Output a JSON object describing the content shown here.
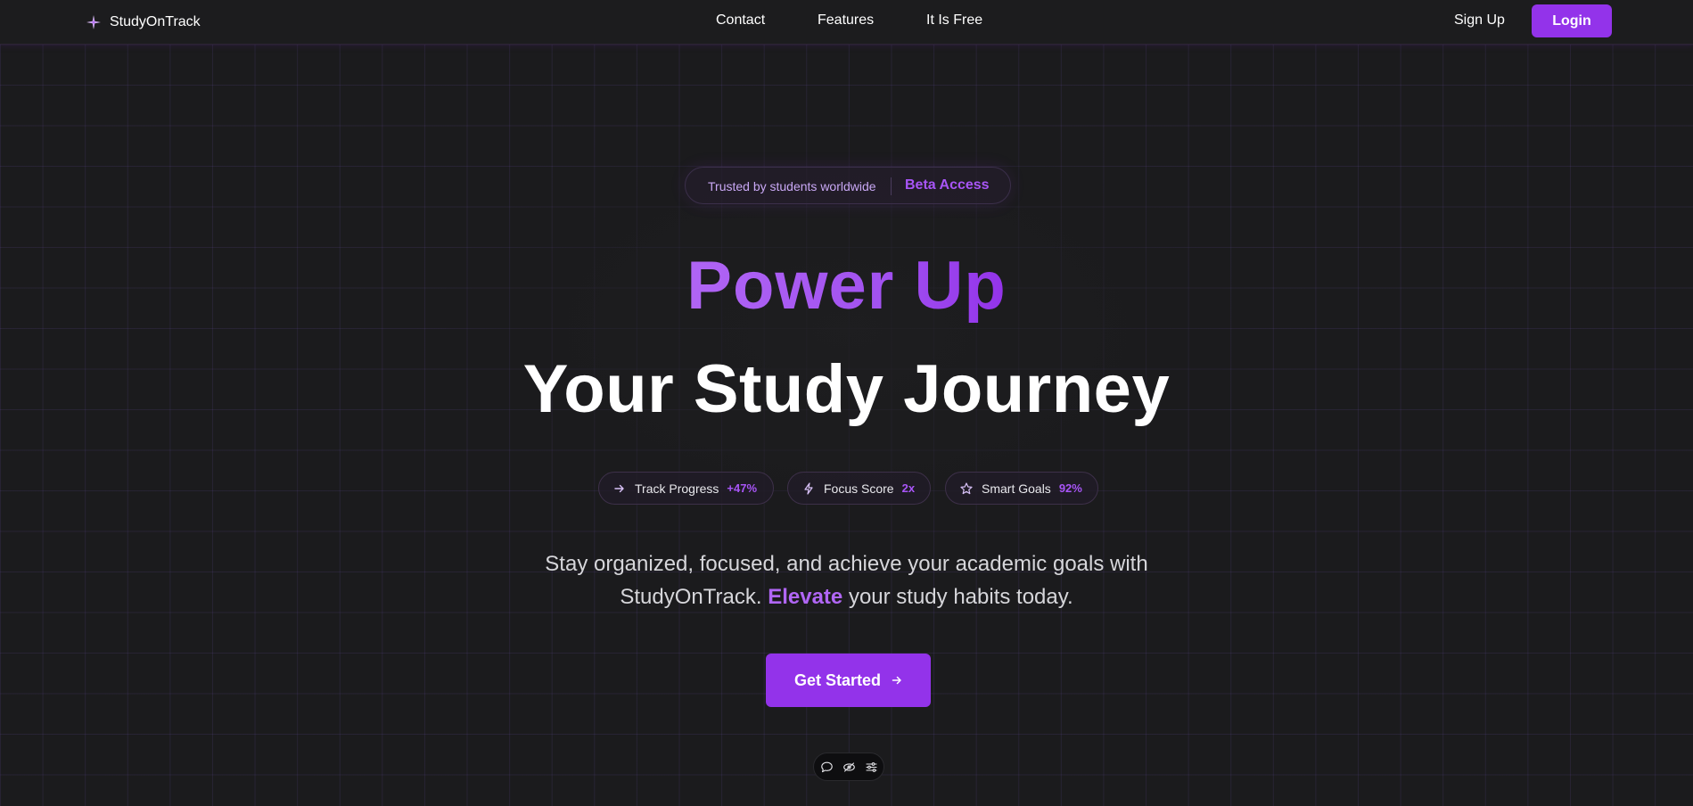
{
  "brand": {
    "name": "StudyOnTrack",
    "icon": "sparkle-icon"
  },
  "nav": {
    "links": [
      "Contact",
      "Features",
      "It Is Free"
    ],
    "signup_label": "Sign Up",
    "login_label": "Login"
  },
  "hero": {
    "badge": {
      "text": "Trusted by students worldwide",
      "highlight": "Beta Access"
    },
    "title_line1": "Power Up",
    "title_line2": "Your Study Journey",
    "stats": [
      {
        "icon": "arrow-right-icon",
        "label": "Track Progress",
        "value": "+47%"
      },
      {
        "icon": "lightning-icon",
        "label": "Focus Score",
        "value": "2x"
      },
      {
        "icon": "star-icon",
        "label": "Smart Goals",
        "value": "92%"
      }
    ],
    "description": {
      "line1": "Stay organized, focused, and achieve your academic goals with",
      "line2_before": "StudyOnTrack.",
      "line2_highlight": "Elevate",
      "line2_after": "your study habits today."
    },
    "cta_label": "Get Started"
  },
  "mini_toolbar": {
    "icons": [
      "chat-bubble-icon",
      "eye-off-icon",
      "sliders-icon"
    ]
  },
  "colors": {
    "accent": "#9333ea",
    "accent_light": "#a855f7",
    "background": "#1b1b1d"
  }
}
